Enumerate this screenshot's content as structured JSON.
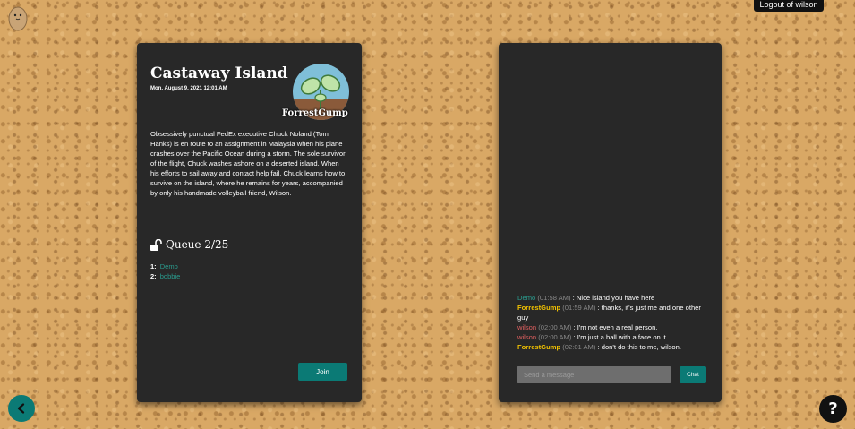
{
  "header": {
    "logout_label": "Logout of wilson"
  },
  "room": {
    "title": "Castaway Island",
    "date": "Mon, August 9, 2021 12:01 AM",
    "host": "ForrestGump",
    "description": "Obsessively punctual FedEx executive Chuck Noland (Tom Hanks) is en route to an assignment in Malaysia when his plane crashes over the Pacific Ocean during a storm. The sole survivor of the flight, Chuck washes ashore on a deserted island. When his efforts to sail away and contact help fail, Chuck learns how to survive on the island, where he remains for years, accompanied by only his handmade volleyball friend, Wilson.",
    "queue_label": "Queue 2/25",
    "queue": [
      {
        "num": "1:",
        "name": "Demo"
      },
      {
        "num": "2:",
        "name": "bobbie"
      }
    ],
    "join_label": "Join"
  },
  "chat": {
    "messages": [
      {
        "user": "Demo",
        "time": "(01:58 AM)",
        "text": ": Nice island you have here"
      },
      {
        "user": "ForrestGump",
        "time": "(01:59 AM)",
        "text": ": thanks, it's just me and one other guy"
      },
      {
        "user": "wilson",
        "time": "(02:00 AM)",
        "text": ": I'm not even a real person."
      },
      {
        "user": "wilson",
        "time": "(02:00 AM)",
        "text": ": I'm just a ball with a face on it"
      },
      {
        "user": "ForrestGump",
        "time": "(02:01 AM)",
        "text": ": don't do this to me, wilson."
      }
    ],
    "input_placeholder": "Send a message",
    "send_label": "Chat"
  },
  "footer": {
    "back_icon": "chevron-left-icon",
    "help_label": "?"
  },
  "colors": {
    "accent": "#0b7a75",
    "card": "#282828",
    "demo": "#2a9d8f",
    "forrest": "#f2c200",
    "wilson": "#e06060"
  }
}
